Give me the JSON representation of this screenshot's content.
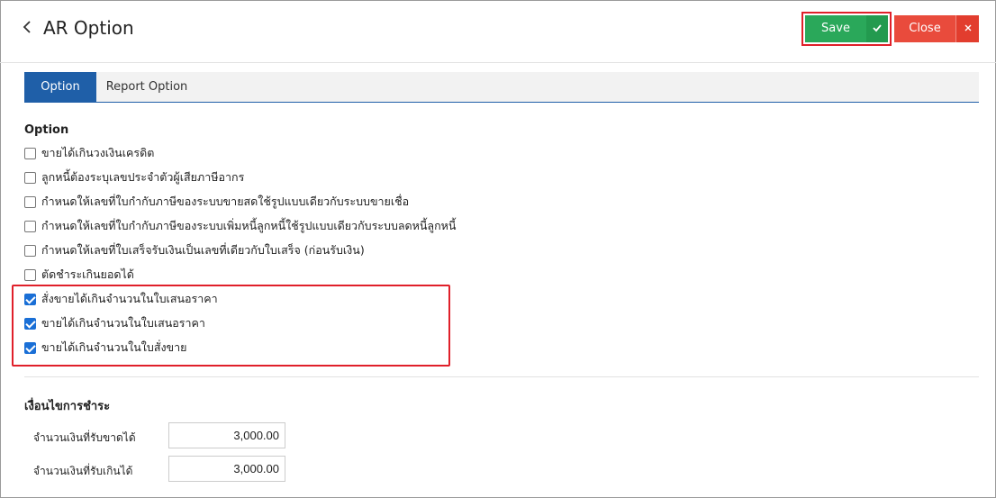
{
  "header": {
    "back_icon": "chevron-left-icon",
    "title": "AR Option",
    "save_label": "Save",
    "save_check_icon": "check-icon",
    "close_label": "Close",
    "close_x_icon": "x-icon"
  },
  "tabs": [
    {
      "label": "Option",
      "active": true
    },
    {
      "label": "Report Option",
      "active": false
    }
  ],
  "option_section": {
    "title": "Option",
    "items": [
      {
        "label": "ขายได้เกินวงเงินเครดิต",
        "checked": false
      },
      {
        "label": "ลูกหนี้ต้องระบุเลขประจำตัวผู้เสียภาษีอากร",
        "checked": false
      },
      {
        "label": "กำหนดให้เลขที่ใบกำกับภาษีของระบบขายสดใช้รูปแบบเดียวกับระบบขายเชื่อ",
        "checked": false
      },
      {
        "label": "กำหนดให้เลขที่ใบกำกับภาษีของระบบเพิ่มหนี้ลูกหนี้ใช้รูปแบบเดียวกับระบบลดหนี้ลูกหนี้",
        "checked": false
      },
      {
        "label": "กำหนดให้เลขที่ใบเสร็จรับเงินเป็นเลขที่เดียวกับใบเสร็จ (ก่อนรับเงิน)",
        "checked": false
      },
      {
        "label": "ตัดชำระเกินยอดได้",
        "checked": false
      },
      {
        "label": "สั่งขายได้เกินจำนวนในใบเสนอราคา",
        "checked": true
      },
      {
        "label": "ขายได้เกินจำนวนในใบเสนอราคา",
        "checked": true
      },
      {
        "label": "ขายได้เกินจำนวนในใบสั่งขาย",
        "checked": true
      }
    ]
  },
  "payment_section": {
    "title": "เงื่อนไขการชำระ",
    "fields": [
      {
        "label": "จำนวนเงินที่รับขาดได้",
        "value": "3,000.00"
      },
      {
        "label": "จำนวนเงินที่รับเกินได้",
        "value": "3,000.00"
      }
    ]
  },
  "colors": {
    "save": "#2aa85a",
    "close": "#e94b3c",
    "tab_active": "#1f5fa8",
    "checkbox_checked": "#1a6fd6",
    "highlight": "#e0202a"
  }
}
